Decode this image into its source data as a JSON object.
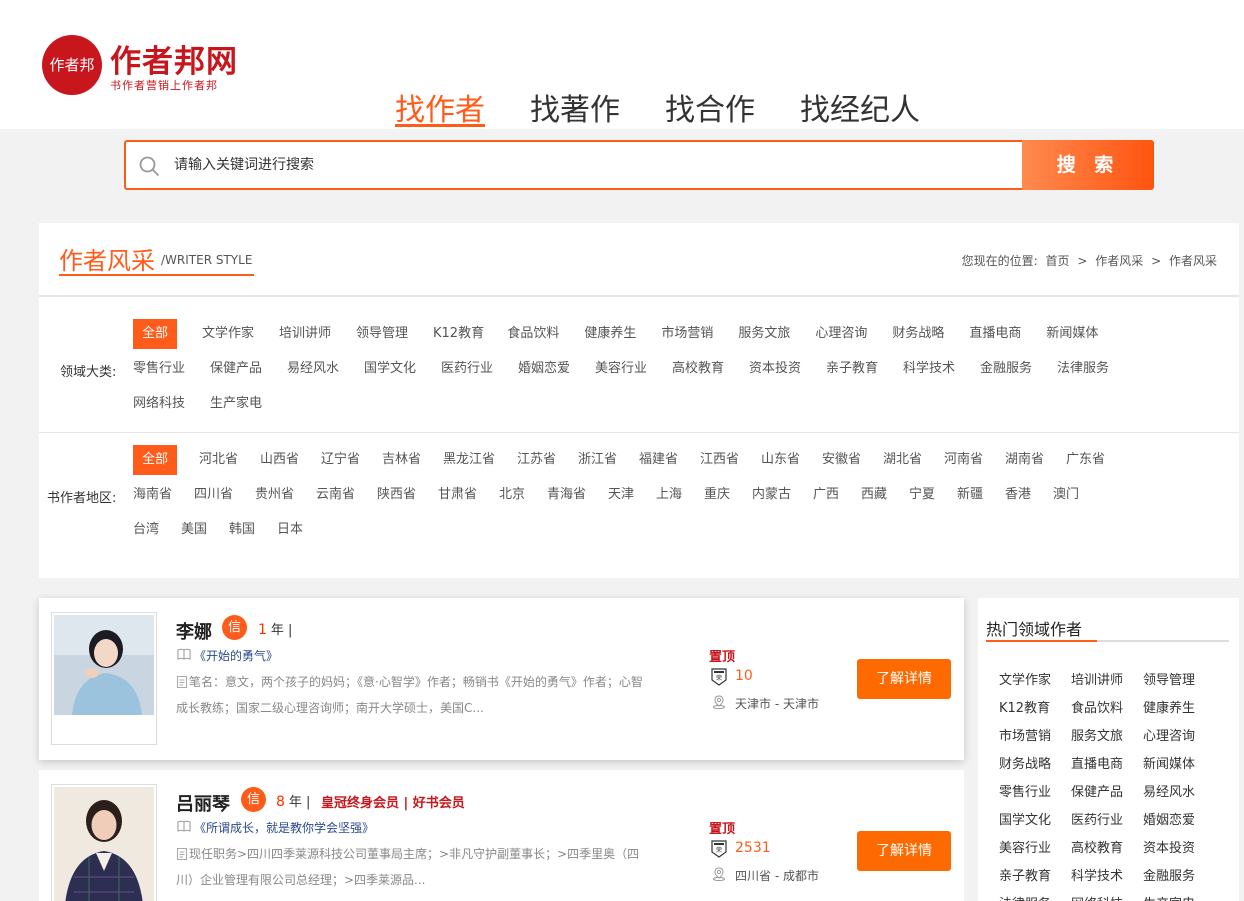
{
  "header": {
    "logo_badge": "作者邦",
    "logo_name": "作者邦网",
    "logo_slogan": "书作者营销上作者邦",
    "nav": [
      "找作者",
      "找著作",
      "找合作",
      "找经纪人"
    ]
  },
  "search": {
    "placeholder": "请输入关键词进行搜索",
    "button_label": "搜 索"
  },
  "filter": {
    "title": "作者风采",
    "subtitle": "/WRITER STYLE",
    "breadcrumb": {
      "prefix": "您现在的位置:",
      "items": [
        "首页",
        "作者风采",
        "作者风采"
      ],
      "separator": ">"
    },
    "domain_label": "领域大类:",
    "domains": [
      "全部",
      "文学作家",
      "培训讲师",
      "领导管理",
      "K12教育",
      "食品饮料",
      "健康养生",
      "市场营销",
      "服务文旅",
      "心理咨询",
      "财务战略",
      "直播电商",
      "新闻媒体",
      "零售行业",
      "保健产品",
      "易经风水",
      "国学文化",
      "医药行业",
      "婚姻恋爱",
      "美容行业",
      "高校教育",
      "资本投资",
      "亲子教育",
      "科学技术",
      "金融服务",
      "法律服务",
      "网络科技",
      "生产家电"
    ],
    "region_label": "书作者地区:",
    "regions": [
      "全部",
      "河北省",
      "山西省",
      "辽宁省",
      "吉林省",
      "黑龙江省",
      "江苏省",
      "浙江省",
      "福建省",
      "江西省",
      "山东省",
      "安徽省",
      "湖北省",
      "河南省",
      "湖南省",
      "广东省",
      "海南省",
      "四川省",
      "贵州省",
      "云南省",
      "陕西省",
      "甘肃省",
      "北京",
      "青海省",
      "天津",
      "上海",
      "重庆",
      "内蒙古",
      "广西",
      "西藏",
      "宁夏",
      "新疆",
      "香港",
      "澳门",
      "台湾",
      "美国",
      "韩国",
      "日本"
    ]
  },
  "authors": [
    {
      "name": "李娜",
      "badge": "信",
      "years": "1",
      "years_suffix": "年 |",
      "member": "",
      "book": "《开始的勇气》",
      "desc": "笔名：意文，两个孩子的妈妈；《意·心智学》作者；畅销书《开始的勇气》作者；心智成长教练；国家二级心理咨询师；南开大学硕士，美国C...",
      "pin": "置顶",
      "fans": "10",
      "location": "天津市 - 天津市",
      "button": "了解详情"
    },
    {
      "name": "吕丽琴",
      "badge": "信",
      "years": "8",
      "years_suffix": "年 |",
      "member": "皇冠终身会员 | 好书会员",
      "book": "《所谓成长，就是教你学会坚强》",
      "desc": "现任职务>四川四季莱源科技公司董事局主席；>非凡守护副董事长；>四季里奥（四川）企业管理有限公司总经理；>四季莱源品...",
      "pin": "置顶",
      "fans": "2531",
      "location": "四川省 - 成都市",
      "button": "了解详情"
    }
  ],
  "sidebar": {
    "title": "热门领域作者",
    "tags": [
      "文学作家",
      "培训讲师",
      "领导管理",
      "K12教育",
      "食品饮料",
      "健康养生",
      "市场营销",
      "服务文旅",
      "心理咨询",
      "财务战略",
      "直播电商",
      "新闻媒体",
      "零售行业",
      "保健产品",
      "易经风水",
      "国学文化",
      "医药行业",
      "婚姻恋爱",
      "美容行业",
      "高校教育",
      "资本投资",
      "亲子教育",
      "科学技术",
      "金融服务",
      "法律服务",
      "网络科技",
      "生产家电"
    ]
  },
  "colors": {
    "accent": "#ff5b1a",
    "brand_red": "#c8161d",
    "button": "#ff6a00"
  }
}
